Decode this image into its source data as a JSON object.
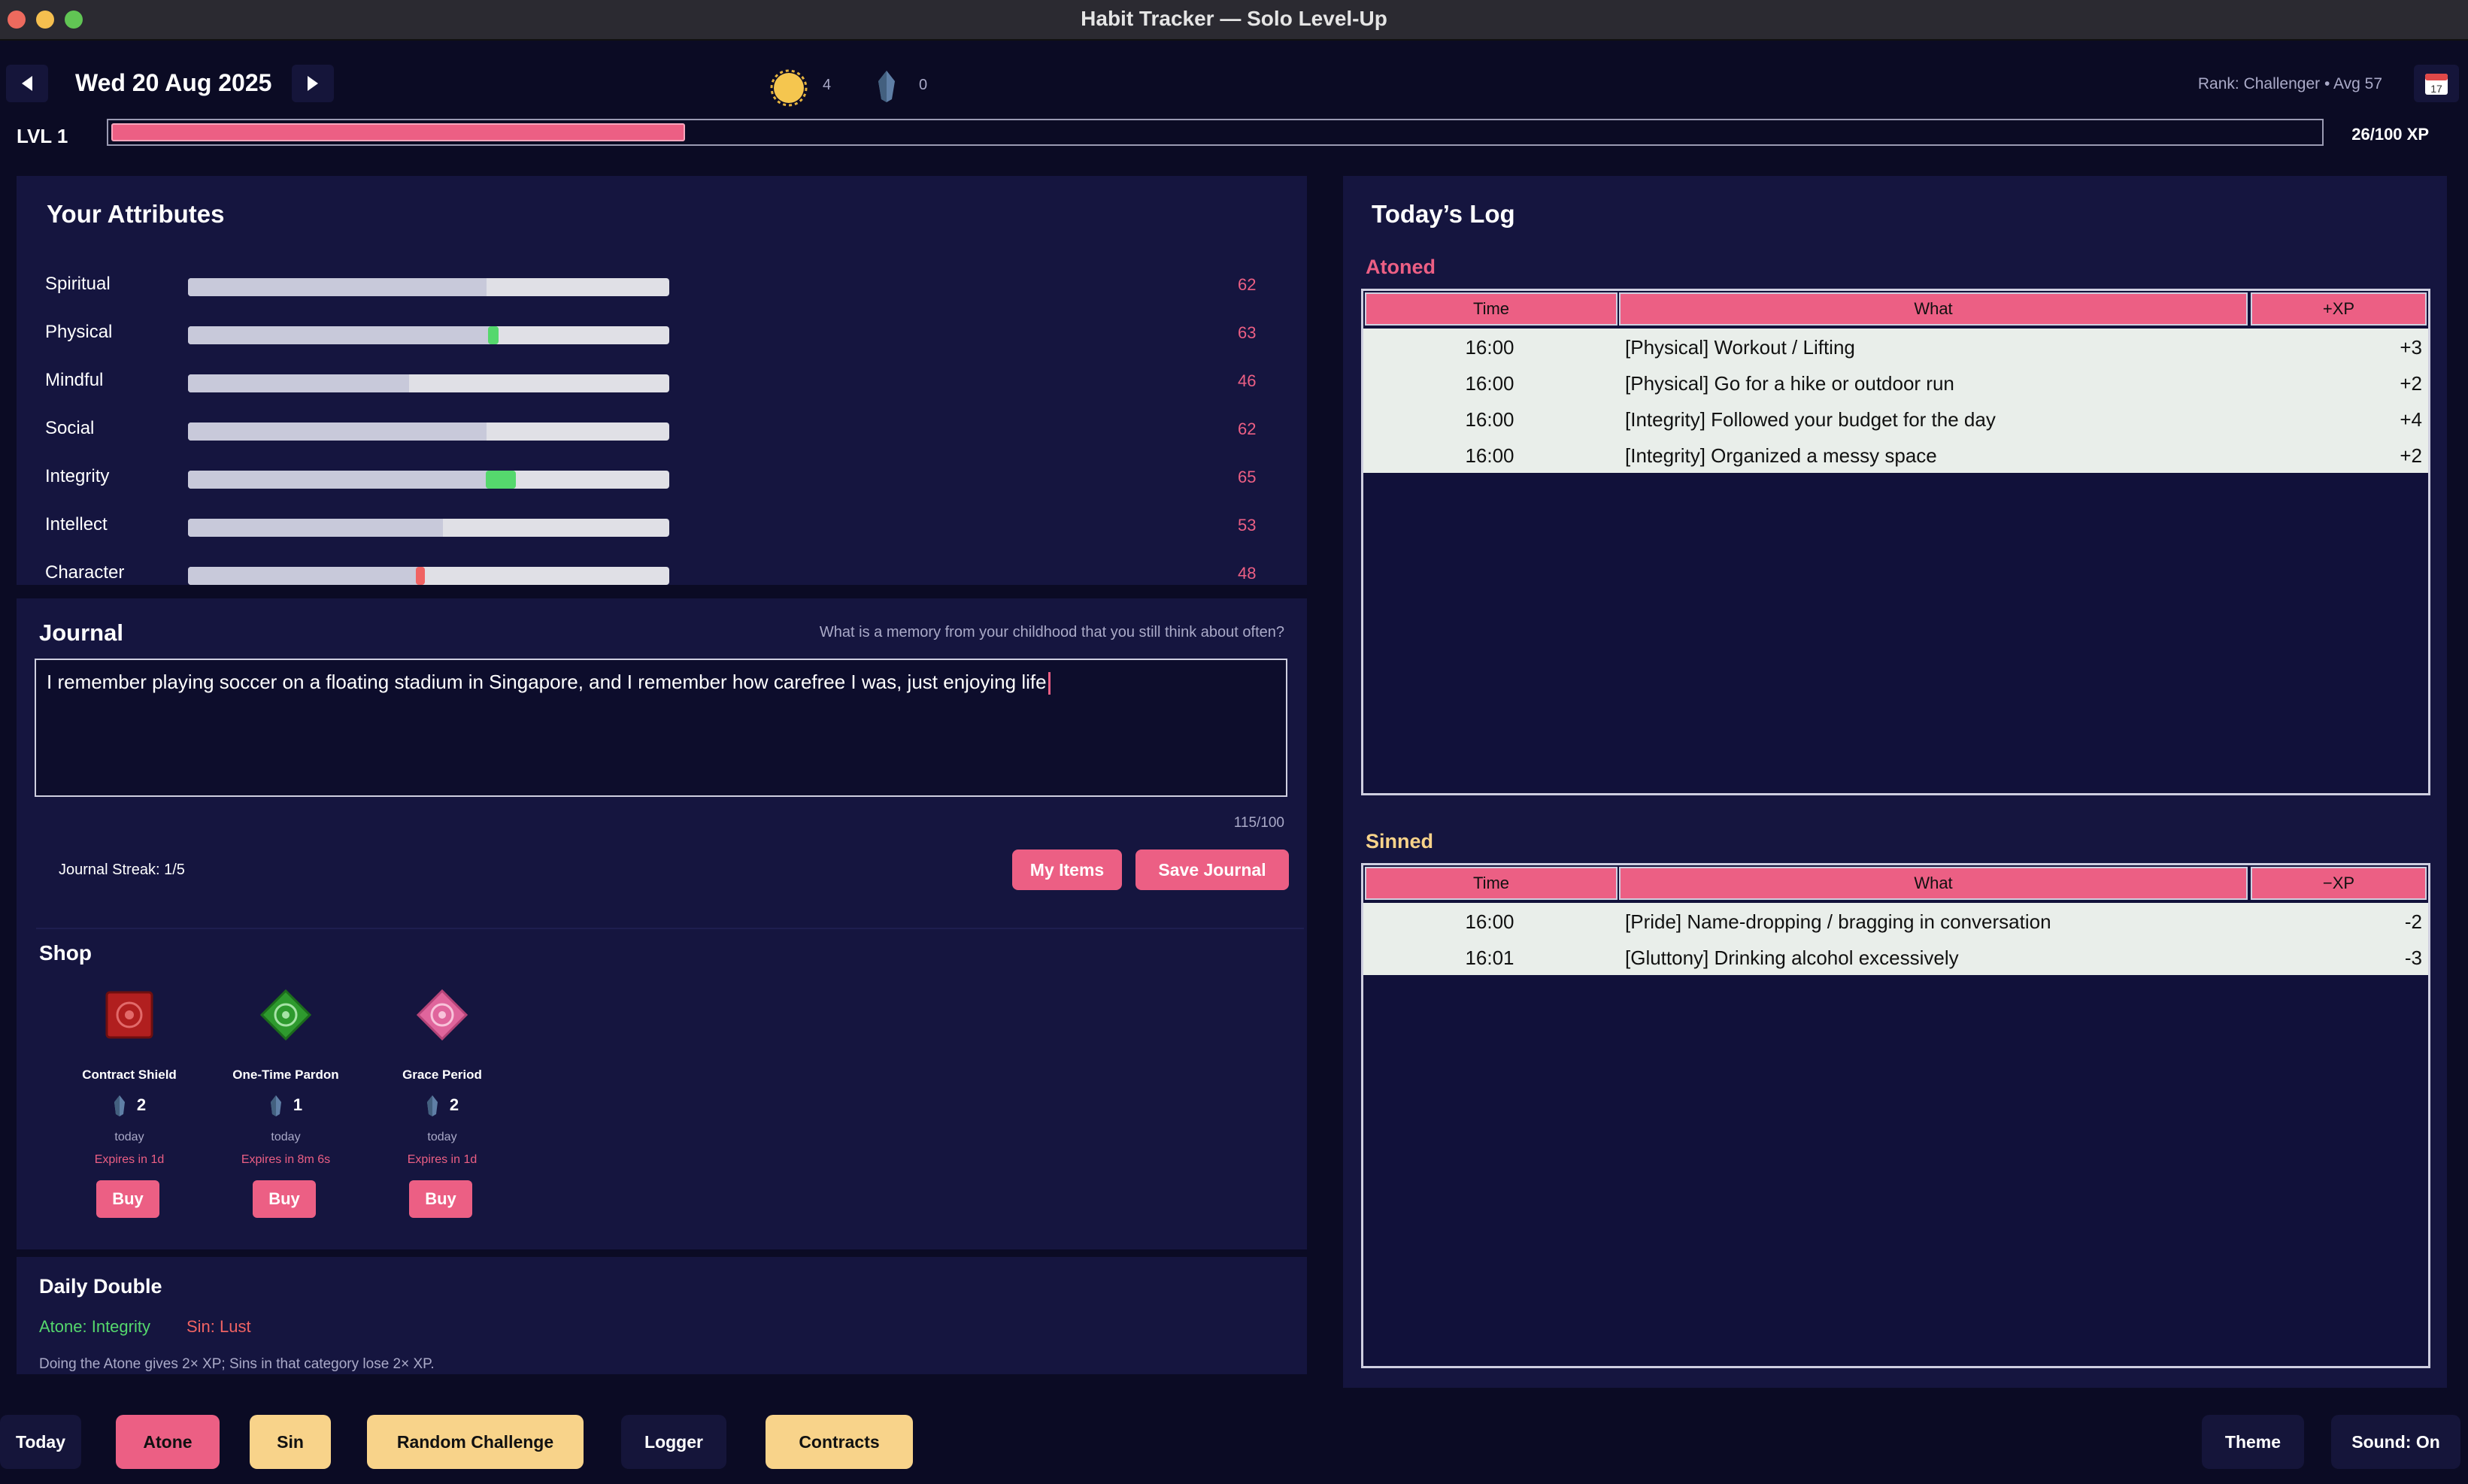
{
  "window": {
    "title": "Habit Tracker — Solo Level-Up"
  },
  "header": {
    "date": "Wed 20 Aug 2025",
    "sun_count": "4",
    "crystal_count": "0",
    "rank": "Rank: Challenger  •  Avg 57",
    "level": "LVL 1",
    "xp_text": "26/100 XP",
    "xp_progress": 0.26,
    "icons": {
      "prev": "left-arrow-icon",
      "next": "right-arrow-icon",
      "calendar": "calendar-icon",
      "calendar_day": "17"
    }
  },
  "attributes": {
    "title": "Your Attributes",
    "items": [
      {
        "label": "Spiritual",
        "value": "62",
        "level": 62,
        "marker": "none"
      },
      {
        "label": "Physical",
        "value": "63",
        "level": 63,
        "marker": "green-small"
      },
      {
        "label": "Mindful",
        "value": "46",
        "level": 46,
        "marker": "none"
      },
      {
        "label": "Social",
        "value": "62",
        "level": 62,
        "marker": "none"
      },
      {
        "label": "Integrity",
        "value": "65",
        "level": 65,
        "marker": "green"
      },
      {
        "label": "Intellect",
        "value": "53",
        "level": 53,
        "marker": "none"
      },
      {
        "label": "Character",
        "value": "48",
        "level": 48,
        "marker": "red"
      }
    ]
  },
  "journal": {
    "title": "Journal",
    "prompt": "What is a memory from your childhood that you still think about often?",
    "text": "I remember playing soccer on a floating stadium in Singapore, and I remember how carefree I was, just enjoying life",
    "char_count": "115/100",
    "streak": "Journal Streak: 1/5",
    "my_items_label": "My Items",
    "save_label": "Save Journal"
  },
  "shop": {
    "title": "Shop",
    "items": [
      {
        "name": "Contract Shield",
        "cost": "2",
        "when": "today",
        "expires": "Expires in 1d",
        "buy": "Buy",
        "icon": "shield-emblem-icon",
        "color": "#b11f1f"
      },
      {
        "name": "One-Time Pardon",
        "cost": "1",
        "when": "today",
        "expires": "Expires in 8m 6s",
        "buy": "Buy",
        "icon": "pardon-emblem-icon",
        "color": "#2e9a2e"
      },
      {
        "name": "Grace Period",
        "cost": "2",
        "when": "today",
        "expires": "Expires in 1d",
        "buy": "Buy",
        "icon": "grace-emblem-icon",
        "color": "#e0659c"
      }
    ]
  },
  "daily_double": {
    "title": "Daily Double",
    "atone": "Atone: Integrity",
    "sin": "Sin: Lust",
    "note": "Doing the Atone gives 2× XP; Sins in that category lose 2× XP."
  },
  "log": {
    "title": "Today’s Log",
    "atoned": {
      "title": "Atoned",
      "columns": [
        "Time",
        "What",
        "+XP"
      ],
      "rows": [
        {
          "time": "16:00",
          "what": "[Physical] Workout / Lifting",
          "xp": "+3"
        },
        {
          "time": "16:00",
          "what": "[Physical] Go for a hike or outdoor run",
          "xp": "+2"
        },
        {
          "time": "16:00",
          "what": "[Integrity] Followed your budget for the day",
          "xp": "+4"
        },
        {
          "time": "16:00",
          "what": "[Integrity] Organized a messy space",
          "xp": "+2"
        }
      ]
    },
    "sinned": {
      "title": "Sinned",
      "columns": [
        "Time",
        "What",
        "−XP"
      ],
      "rows": [
        {
          "time": "16:00",
          "what": "[Pride] Name-dropping / bragging in conversation",
          "xp": "-2"
        },
        {
          "time": "16:01",
          "what": "[Gluttony] Drinking alcohol excessively",
          "xp": "-3"
        }
      ]
    }
  },
  "bottom_bar": {
    "today": "Today",
    "atone": "Atone",
    "sin": "Sin",
    "random_challenge": "Random Challenge",
    "logger": "Logger",
    "contracts": "Contracts",
    "theme": "Theme",
    "sound": "Sound: On"
  },
  "colors": {
    "accent_pink": "#ec5f84",
    "accent_yellow": "#f8d38a",
    "atoned_title": "#ec5f84",
    "sinned_title": "#f8d38a",
    "green": "#55d86d",
    "red": "#f06363"
  }
}
